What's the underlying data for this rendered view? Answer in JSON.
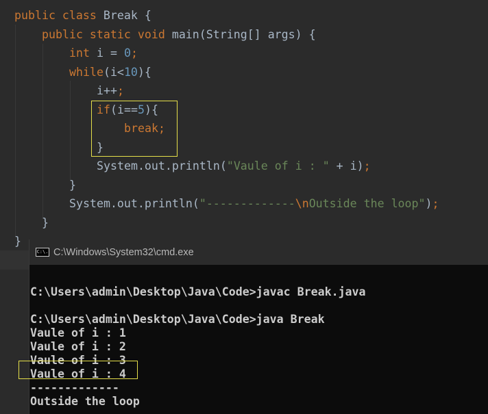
{
  "editor": {
    "lines": [
      {
        "indent": 0,
        "tokens": [
          [
            "public class ",
            "kw"
          ],
          [
            "Break {",
            "txt"
          ]
        ]
      },
      {
        "indent": 1,
        "tokens": [
          [
            "public static void ",
            "kw"
          ],
          [
            "main(String[] args) {",
            "txt"
          ]
        ]
      },
      {
        "indent": 2,
        "tokens": [
          [
            "int ",
            "kw"
          ],
          [
            "i = ",
            "txt"
          ],
          [
            "0",
            "num"
          ],
          [
            ";",
            "kw"
          ]
        ]
      },
      {
        "indent": 2,
        "tokens": [
          [
            "while",
            "kw"
          ],
          [
            "(i<",
            "txt"
          ],
          [
            "10",
            "num"
          ],
          [
            "){",
            "txt"
          ]
        ]
      },
      {
        "indent": 3,
        "tokens": [
          [
            "i++",
            "txt"
          ],
          [
            ";",
            "kw"
          ]
        ]
      },
      {
        "indent": 3,
        "tokens": [
          [
            "if",
            "kw"
          ],
          [
            "(i==",
            "txt"
          ],
          [
            "5",
            "num"
          ],
          [
            "){",
            "txt"
          ]
        ]
      },
      {
        "indent": 4,
        "tokens": [
          [
            "break;",
            "kw"
          ]
        ]
      },
      {
        "indent": 3,
        "tokens": [
          [
            "}",
            "txt"
          ]
        ]
      },
      {
        "indent": 3,
        "tokens": [
          [
            "System.out.println(",
            "txt"
          ],
          [
            "\"Vaule of i : \"",
            "str"
          ],
          [
            " + i)",
            "txt"
          ],
          [
            ";",
            "kw"
          ]
        ]
      },
      {
        "indent": 2,
        "tokens": [
          [
            "}",
            "txt"
          ]
        ]
      },
      {
        "indent": 2,
        "tokens": [
          [
            "System.out.println(",
            "txt"
          ],
          [
            "\"-------------",
            "str"
          ],
          [
            "\\n",
            "kw"
          ],
          [
            "Outside the loop\"",
            "str"
          ],
          [
            ")",
            "txt"
          ],
          [
            ";",
            "kw"
          ]
        ]
      },
      {
        "indent": 1,
        "tokens": [
          [
            "}",
            "txt"
          ]
        ]
      },
      {
        "indent": 0,
        "tokens": [
          [
            "}",
            "txt"
          ]
        ]
      }
    ],
    "highlight_color": "#e6e04a"
  },
  "console": {
    "title": "C:\\Windows\\System32\\cmd.exe",
    "icon_text": "C:\\.",
    "lines": [
      "",
      "C:\\Users\\admin\\Desktop\\Java\\Code>javac Break.java",
      "",
      "C:\\Users\\admin\\Desktop\\Java\\Code>java Break",
      "Vaule of i : 1",
      "Vaule of i : 2",
      "Vaule of i : 3",
      "Vaule of i : 4",
      "-------------",
      "Outside the loop"
    ]
  }
}
